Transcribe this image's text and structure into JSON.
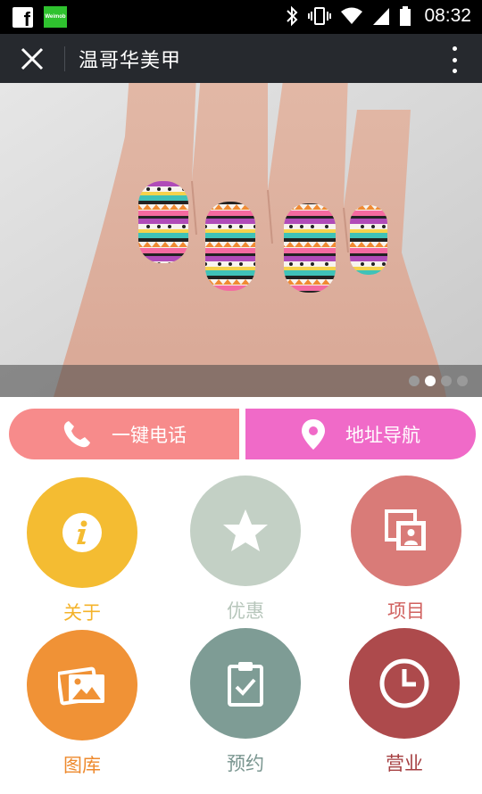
{
  "status_bar": {
    "time": "08:32",
    "app_badge": "Weimob",
    "icons": [
      "facebook-icon",
      "weimob-icon",
      "bluetooth-icon",
      "vibrate-icon",
      "wifi-icon",
      "signal-icon",
      "battery-icon"
    ]
  },
  "header": {
    "title": "温哥华美甲",
    "close_icon": "close-icon",
    "more_icon": "more-vertical-icon"
  },
  "carousel": {
    "slide_count": 4,
    "active_index": 1
  },
  "actions": {
    "call_label": "一键电话",
    "nav_label": "地址导航",
    "call_color": "#f78b8b",
    "nav_color": "#f06ac8"
  },
  "grid": [
    {
      "label": "关于",
      "icon": "info-icon",
      "color": "#f4bc32",
      "label_color": "#f4b32a"
    },
    {
      "label": "优惠",
      "icon": "star-icon",
      "color": "#c3d0c5",
      "label_color": "#b7c6bb"
    },
    {
      "label": "项目",
      "icon": "photos-icon",
      "color": "#d97b78",
      "label_color": "#d0605e"
    },
    {
      "label": "图库",
      "icon": "gallery-icon",
      "color": "#f09236",
      "label_color": "#ee8a2e"
    },
    {
      "label": "预约",
      "icon": "clipboard-check-icon",
      "color": "#7e9c95",
      "label_color": "#7a9690"
    },
    {
      "label": "营业",
      "icon": "clock-icon",
      "color": "#ad4a4c",
      "label_color": "#a53e40"
    }
  ]
}
